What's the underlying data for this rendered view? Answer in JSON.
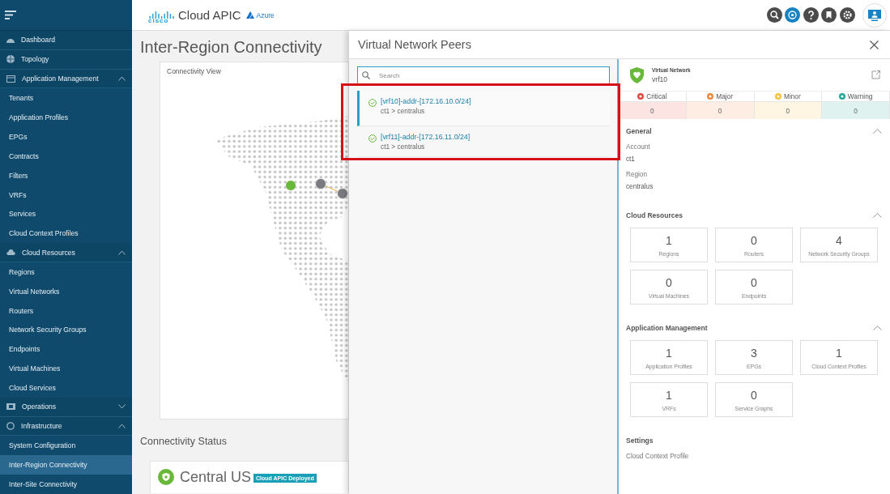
{
  "header": {
    "logo_text": "cisco",
    "product": "Cloud APIC",
    "cloud": "Azure"
  },
  "sidebar": {
    "items": [
      {
        "label": "Dashboard",
        "selected": false
      },
      {
        "label": "Topology",
        "selected": false
      },
      {
        "label": "Application Management",
        "selected": false,
        "expanded": true,
        "children": [
          {
            "label": "Tenants",
            "selected": false
          },
          {
            "label": "Application Profiles",
            "selected": false
          },
          {
            "label": "EPGs",
            "selected": false
          },
          {
            "label": "Contracts",
            "selected": false
          },
          {
            "label": "Filters",
            "selected": false
          },
          {
            "label": "VRFs",
            "selected": false
          },
          {
            "label": "Services",
            "selected": false
          },
          {
            "label": "Cloud Context Profiles",
            "selected": false
          }
        ]
      },
      {
        "label": "Cloud Resources",
        "selected": false,
        "expanded": true,
        "children": [
          {
            "label": "Regions",
            "selected": false
          },
          {
            "label": "Virtual Networks",
            "selected": false
          },
          {
            "label": "Routers",
            "selected": false
          },
          {
            "label": "Network Security Groups",
            "selected": false
          },
          {
            "label": "Endpoints",
            "selected": false
          },
          {
            "label": "Virtual Machines",
            "selected": false
          },
          {
            "label": "Cloud Services",
            "selected": false
          }
        ]
      },
      {
        "label": "Operations",
        "selected": false,
        "expanded": false
      },
      {
        "label": "Infrastructure",
        "selected": false,
        "expanded": true,
        "children": [
          {
            "label": "System Configuration",
            "selected": false
          },
          {
            "label": "Inter-Region Connectivity",
            "selected": true
          },
          {
            "label": "Inter-Site Connectivity",
            "selected": false
          }
        ]
      }
    ]
  },
  "page": {
    "title": "Inter-Region Connectivity",
    "connectivity_view": {
      "title": "Connectivity View"
    },
    "connectivity_status": {
      "title": "Connectivity Status",
      "region": "Central US",
      "badge": "Cloud APIC Deployed"
    }
  },
  "peers_panel": {
    "title": "Virtual Network Peers",
    "search": {
      "placeholder": "Search"
    },
    "peers": [
      {
        "name": "[vrf10]-addr-[172.16.10.0/24]",
        "path": "ct1 > centralus",
        "selected": true
      },
      {
        "name": "[vrf11]-addr-[172.16.11.0/24]",
        "path": "ct1 > centralus",
        "selected": false
      }
    ]
  },
  "detail": {
    "type": "Virtual Network",
    "name": "vrf10",
    "faults": [
      {
        "label": "Critical",
        "count": "0",
        "color": "#e2483d"
      },
      {
        "label": "Major",
        "count": "0",
        "color": "#f0883a"
      },
      {
        "label": "Minor",
        "count": "0",
        "color": "#f5c242"
      },
      {
        "label": "Warning",
        "count": "0",
        "color": "#26a69a"
      }
    ],
    "sections": [
      {
        "title": "General",
        "expanded": true,
        "fields": [
          {
            "label": "Account",
            "value": "ct1"
          },
          {
            "label": "Region",
            "value": "centralus"
          }
        ]
      },
      {
        "title": "Cloud Resources",
        "expanded": true,
        "tiles": [
          {
            "count": "1",
            "label": "Regions"
          },
          {
            "count": "0",
            "label": "Routers"
          },
          {
            "count": "4",
            "label": "Network Security Groups"
          },
          {
            "count": "0",
            "label": "Virtual Machines"
          },
          {
            "count": "0",
            "label": "Endpoints"
          }
        ]
      },
      {
        "title": "Application Management",
        "expanded": true,
        "tiles": [
          {
            "count": "1",
            "label": "Application Profiles"
          },
          {
            "count": "3",
            "label": "EPGs"
          },
          {
            "count": "1",
            "label": "Cloud Context Profiles"
          },
          {
            "count": "1",
            "label": "VRFs"
          },
          {
            "count": "0",
            "label": "Service Graphs"
          }
        ]
      },
      {
        "title": "Settings",
        "fields": [
          {
            "label": "Cloud Context Profile"
          }
        ]
      }
    ]
  }
}
